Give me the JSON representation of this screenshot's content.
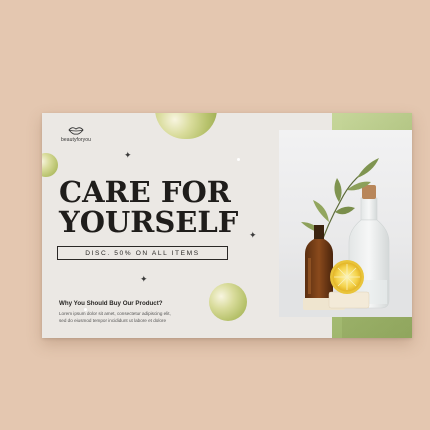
{
  "brand": {
    "name": "beautyforyou"
  },
  "hero": {
    "line1": "CARE FOR",
    "line2": "YOURSELF",
    "discount": "DISC. 50% ON ALL ITEMS"
  },
  "info": {
    "heading": "Why You Should Buy Our Product?",
    "body_line1": "Lorem ipsum dolor sit amet, consectetur adipiscing elit,",
    "body_line2": "sed do eiusmod tempor incididunt ut labore et dolore"
  },
  "colors": {
    "background": "#e4c7b0",
    "card": "#ebe8e4",
    "accent_green": "#b3c67e",
    "text_dark": "#1f1d1b"
  },
  "icons": [
    "lips-logo-icon",
    "sparkle-icon",
    "orb-decoration"
  ]
}
